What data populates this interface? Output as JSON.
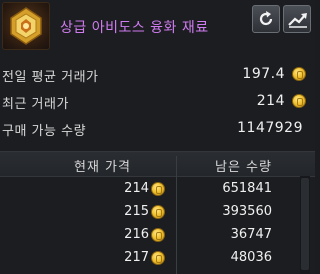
{
  "item": {
    "name": "상급 아비도스 융화 재료",
    "icon": "fusion-material-icon",
    "name_color": "#d07cf0"
  },
  "buttons": {
    "refresh_icon": "refresh-icon",
    "chart_icon": "price-chart-icon"
  },
  "info": {
    "prev_avg_label": "전일 평균 거래가",
    "prev_avg_value": "197.4",
    "recent_label": "최근 거래가",
    "recent_value": "214",
    "buyable_label": "구매 가능 수량",
    "buyable_value": "1147929"
  },
  "table": {
    "headers": [
      "현재 가격",
      "남은 수량"
    ],
    "rows": [
      {
        "price": "214",
        "qty": "651841"
      },
      {
        "price": "215",
        "qty": "393560"
      },
      {
        "price": "216",
        "qty": "36747"
      },
      {
        "price": "217",
        "qty": "48036"
      }
    ]
  },
  "colors": {
    "coin": "#f1c232",
    "background": "#1b1d20"
  }
}
